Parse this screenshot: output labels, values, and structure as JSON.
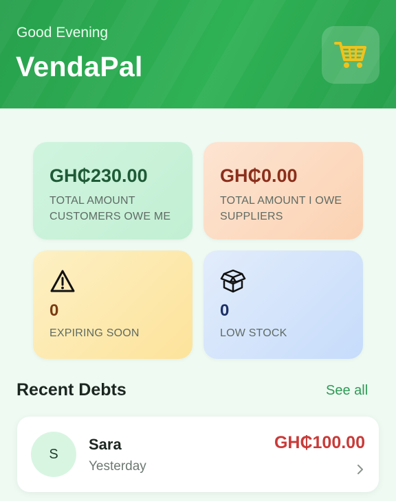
{
  "header": {
    "greeting": "Good Evening",
    "title": "VendaPal",
    "cart_icon": "shopping-cart-icon",
    "background_color": "#2aa750"
  },
  "summary_cards": {
    "customers_owe": {
      "amount": "GH₵230.00",
      "label": "TOTAL AMOUNT CUSTOMERS OWE ME",
      "color": "#1f5a36"
    },
    "supplier_owe": {
      "amount": "GH₵0.00",
      "label": "TOTAL AMOUNT I OWE SUPPLIERS",
      "color": "#8a2f1c"
    },
    "expiring": {
      "icon": "warning-triangle-icon",
      "count": "0",
      "label": "EXPIRING SOON",
      "color": "#7a3b12"
    },
    "low_stock": {
      "icon": "open-box-icon",
      "count": "0",
      "label": "LOW STOCK",
      "color": "#1c2f66"
    }
  },
  "recent_debts": {
    "title": "Recent Debts",
    "see_all": "See all",
    "items": [
      {
        "initial": "S",
        "name": "Sara",
        "date": "Yesterday",
        "amount": "GH₵100.00",
        "chevron_icon": "chevron-right-icon"
      }
    ]
  }
}
